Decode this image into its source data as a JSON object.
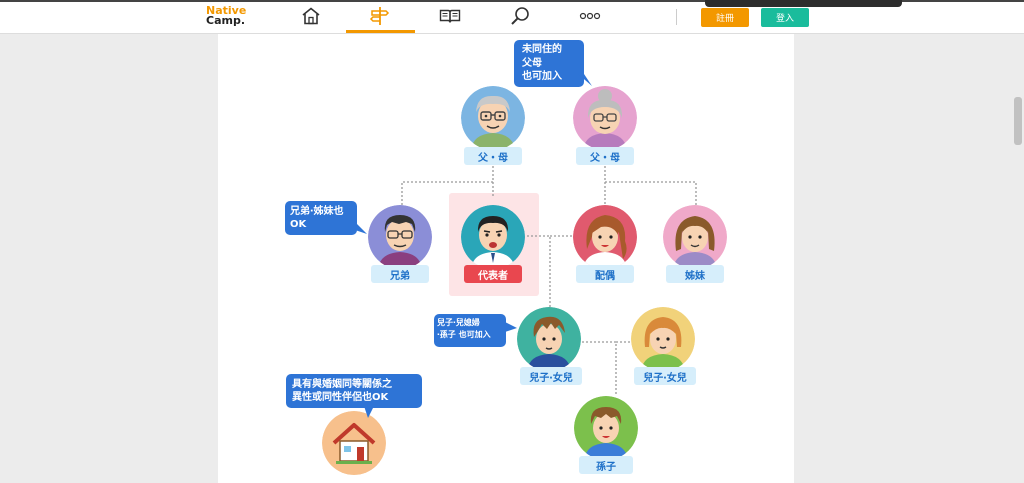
{
  "header": {
    "logo_line1": "Native",
    "logo_line2": "Camp.",
    "nav": [
      "home-icon",
      "pin-icon",
      "book-icon",
      "search-icon",
      "more-icon"
    ],
    "active_nav": "pin-icon",
    "register_label": "註冊",
    "login_label": "登入"
  },
  "colors": {
    "accent": "#f39800",
    "login": "#1abc9c",
    "bubble": "#2e74d6",
    "label_bg": "#d6eefb",
    "label_text": "#1e70c8",
    "representative": "#e9474f"
  },
  "family_tree": {
    "father_label": "父・母",
    "mother_label": "父・母",
    "brother_label": "兄弟",
    "representative_label": "代表者",
    "spouse_label": "配偶",
    "sister_label": "姊妹",
    "son_label": "兒子‧女兒",
    "daughter_label": "兒子‧女兒",
    "grandson_label": "孫子"
  },
  "bubbles": {
    "parents": [
      "未同住的",
      "父母",
      "也可加入"
    ],
    "siblings": [
      "兄弟‧姊妹也",
      "OK"
    ],
    "children": [
      "兒子‧兒媳婦",
      "‧孫子 也可加入"
    ],
    "partner": [
      "具有與婚姻同等關係之",
      "異性或同性伴侶也OK"
    ]
  }
}
